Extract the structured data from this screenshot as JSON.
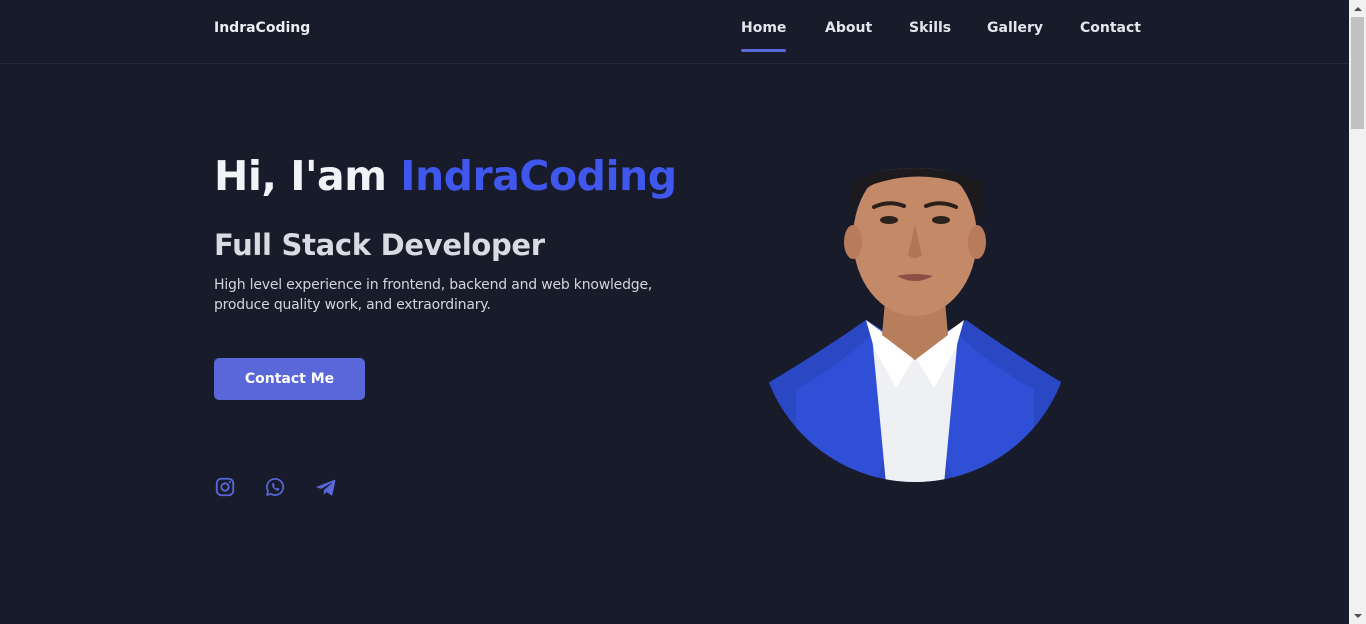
{
  "brand": "IndraCoding",
  "nav": {
    "home": "Home",
    "about": "About",
    "skills": "Skills",
    "gallery": "Gallery",
    "contact": "Contact",
    "active": "Home"
  },
  "hero": {
    "greeting": "Hi, I'am",
    "name": "IndraCoding",
    "role": "Full Stack Developer",
    "description": "High level experience in frontend, backend and web knowledge, produce quality work, and extraordinary.",
    "cta_label": "Contact Me"
  },
  "social": {
    "icons": [
      "instagram-icon",
      "whatsapp-icon",
      "telegram-icon"
    ]
  },
  "colors": {
    "background": "#181b2a",
    "accent": "#3f57ec",
    "button": "#5a67d8",
    "icon": "#5a67d8"
  }
}
